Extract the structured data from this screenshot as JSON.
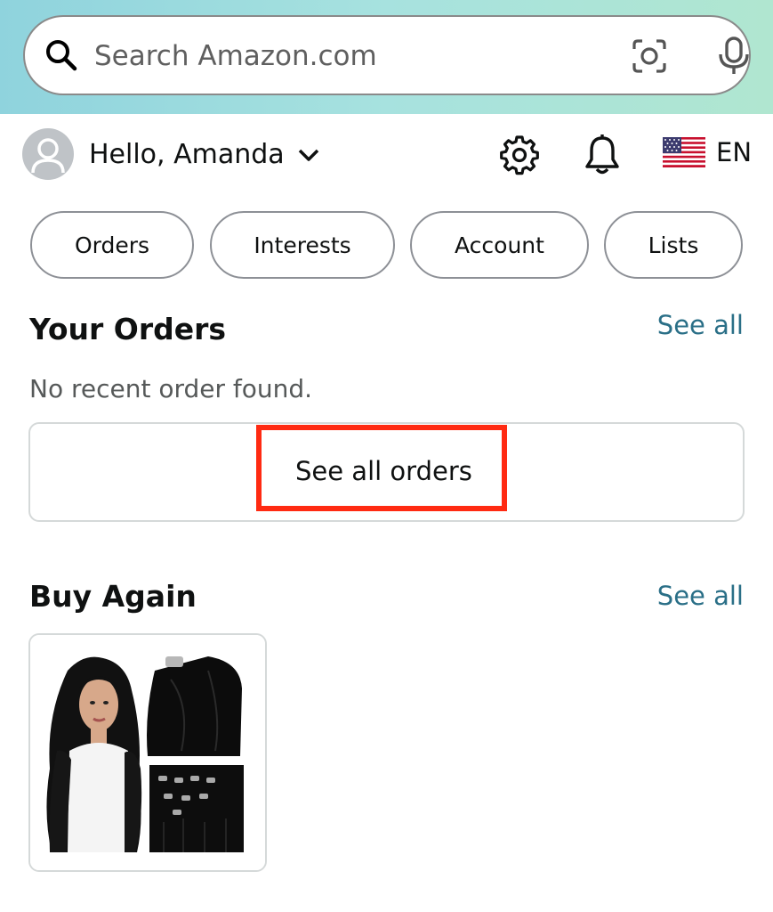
{
  "search": {
    "placeholder": "Search Amazon.com",
    "icons": [
      "search-icon",
      "camera-lens-icon",
      "microphone-icon"
    ]
  },
  "user": {
    "greeting": "Hello, Amanda",
    "language": "EN"
  },
  "header_icons": [
    "settings-gear-icon",
    "notifications-bell-icon",
    "us-flag-icon"
  ],
  "pills": [
    "Orders",
    "Interests",
    "Account",
    "Lists"
  ],
  "your_orders": {
    "title": "Your Orders",
    "see_all": "See all",
    "empty_message": "No recent order found.",
    "button_label": "See all orders"
  },
  "buy_again": {
    "title": "Buy Again",
    "see_all": "See all",
    "items": [
      {
        "image": "black-hair-extensions-product-image"
      }
    ]
  },
  "colors": {
    "accent_link": "#2a6f87",
    "highlight": "#ff2a12",
    "gradient_start": "#8fd3dd",
    "gradient_end": "#b0e6d0"
  }
}
